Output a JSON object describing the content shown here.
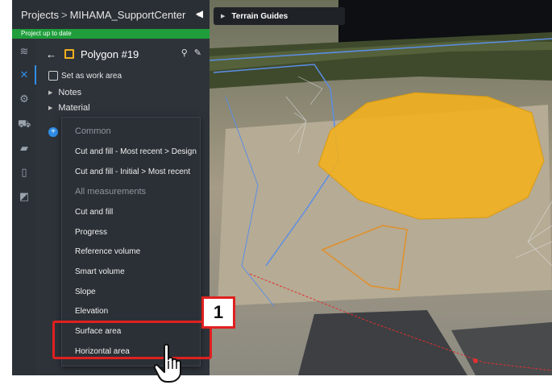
{
  "topbar": {
    "projects_label": "Projects",
    "separator": ">",
    "project_name": "MIHAMA_SupportCenter",
    "status": "Project up to date"
  },
  "panel": {
    "title": "Polygon #19",
    "work_area_label": "Set as work area",
    "notes_label": "Notes",
    "material_label": "Material"
  },
  "menu": {
    "group_common": "Common",
    "common_items": [
      "Cut and fill - Most recent > Design",
      "Cut and fill - Initial > Most recent"
    ],
    "group_all": "All measurements",
    "all_items": [
      "Cut and fill",
      "Progress",
      "Reference volume",
      "Smart volume",
      "Slope",
      "Elevation",
      "Surface area",
      "Horizontal area"
    ]
  },
  "viewer": {
    "terrain_guides_label": "Terrain Guides"
  },
  "annotation": {
    "step_number": "1"
  },
  "colors": {
    "accent": "#2f8ee6",
    "status_green": "#1f9e3b",
    "polygon_yellow": "#f2b01e",
    "annotation_red": "#e02020"
  }
}
